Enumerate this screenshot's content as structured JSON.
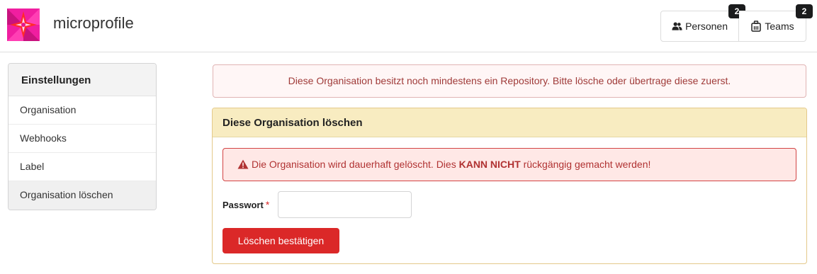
{
  "header": {
    "org_name": "microprofile",
    "logo_icon": "organization-avatar",
    "members": {
      "label": "Personen",
      "count": "2",
      "icon": "users-icon"
    },
    "teams": {
      "label": "Teams",
      "count": "2",
      "icon": "briefcase-icon"
    }
  },
  "sidebar": {
    "title": "Einstellungen",
    "items": [
      {
        "label": "Organisation"
      },
      {
        "label": "Webhooks"
      },
      {
        "label": "Label"
      },
      {
        "label": "Organisation löschen",
        "active": true
      }
    ]
  },
  "error_message": "Diese Organisation besitzt noch mindestens ein Repository. Bitte lösche oder übertrage diese zuerst.",
  "delete_section": {
    "title": "Diese Organisation löschen",
    "warning_prefix": "Die Organisation wird dauerhaft gelöscht. Dies ",
    "warning_strong": "KANN NICHT",
    "warning_suffix": " rückgängig gemacht werden!",
    "password_label": "Passwort",
    "required_mark": "*",
    "password_value": "",
    "confirm_button": "Löschen bestätigen"
  },
  "colors": {
    "danger_button": "#db2828",
    "error_text": "#9f3a38",
    "warning_header_bg": "#f8ecc1",
    "logo_primary": "#e8178a"
  }
}
